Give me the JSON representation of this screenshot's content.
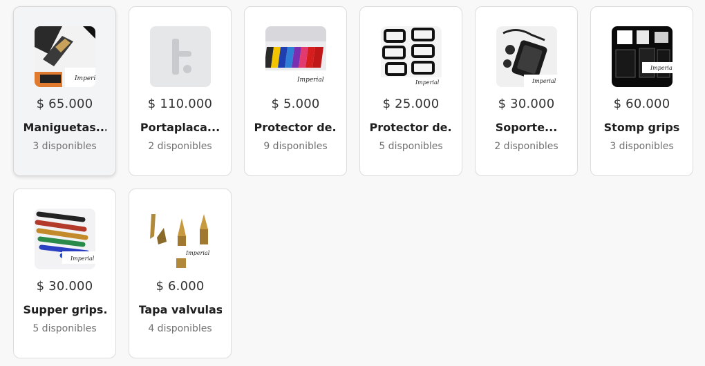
{
  "products": [
    {
      "price": "$ 65.000",
      "name": "Maniguetas...",
      "stock": "3 disponibles",
      "thumb": "maniguetas-image",
      "selected": true
    },
    {
      "price": "$ 110.000",
      "name": "Portaplaca...",
      "stock": "2 disponibles",
      "thumb": "placeholder-logo-icon",
      "selected": false
    },
    {
      "price": "$ 5.000",
      "name": "Protector de..",
      "stock": "9 disponibles",
      "thumb": "protector-colors-image",
      "selected": false
    },
    {
      "price": "$ 25.000",
      "name": "Protector de..",
      "stock": "5 disponibles",
      "thumb": "protector-frames-image",
      "selected": false
    },
    {
      "price": "$ 30.000",
      "name": "Soporte...",
      "stock": "2 disponibles",
      "thumb": "soporte-image",
      "selected": false
    },
    {
      "price": "$ 60.000",
      "name": "Stomp grips",
      "stock": "3 disponibles",
      "thumb": "stomp-grips-image",
      "selected": false
    },
    {
      "price": "$ 30.000",
      "name": "Supper grips..",
      "stock": "5 disponibles",
      "thumb": "supper-grips-image",
      "selected": false
    },
    {
      "price": "$ 6.000",
      "name": "Tapa valvulas",
      "stock": "4 disponibles",
      "thumb": "tapa-valvulas-image",
      "selected": false
    }
  ],
  "watermark": "Imperial",
  "placeholder_letter": "t"
}
